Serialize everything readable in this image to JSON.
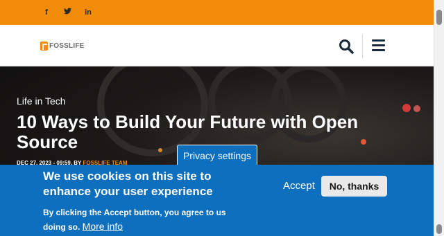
{
  "topbar": {
    "social": [
      {
        "icon": "facebook-icon",
        "glyph": "f"
      },
      {
        "icon": "twitter-icon",
        "glyph": "🐦"
      },
      {
        "icon": "linkedin-icon",
        "glyph": "in"
      }
    ]
  },
  "header": {
    "logo_text": "FOSSLIFE",
    "search_icon": "search-icon",
    "menu_icon": "hamburger-menu-icon"
  },
  "hero": {
    "category": "Life in Tech",
    "title": "10 Ways to Build Your Future with Open Source",
    "date": "DEC 27, 2023 - 09:59,",
    "by": "BY",
    "author": "FOSSLIFE TEAM"
  },
  "privacy_tab": {
    "label": "Privacy settings"
  },
  "cookie_banner": {
    "title": "We use cookies on this site to enhance your user experience",
    "body": "By clicking the Accept button, you agree to us doing so.",
    "more_info": "More info",
    "accept_label": "Accept",
    "decline_label": "No, thanks"
  },
  "colors": {
    "brand_orange": "#f08c0a",
    "banner_blue": "#0e6fbe"
  }
}
